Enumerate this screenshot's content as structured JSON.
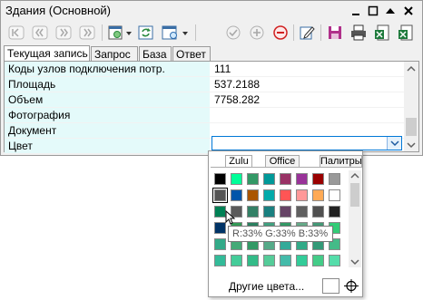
{
  "window": {
    "title": "Здания (Основной)"
  },
  "tabs": [
    {
      "label": "Текущая запись",
      "active": true
    },
    {
      "label": "Запрос",
      "active": false
    },
    {
      "label": "База",
      "active": false
    },
    {
      "label": "Ответ",
      "active": false
    }
  ],
  "rows": [
    {
      "name": "Коды узлов подключения потр.",
      "value": "111"
    },
    {
      "name": "Площадь",
      "value": "537.2188"
    },
    {
      "name": "Объем",
      "value": "7758.282"
    },
    {
      "name": "Фотография",
      "value": ""
    },
    {
      "name": "Документ",
      "value": ""
    },
    {
      "name": "Цвет",
      "value": ""
    }
  ],
  "color_popup": {
    "tabs": [
      "Zulu",
      "Office",
      "Палитры"
    ],
    "active_tab": "Zulu",
    "tooltip": "R:33% G:33% B:33%",
    "more_colors_label": "Другие цвета...",
    "swatches": [
      [
        "#000000",
        "#00ff99",
        "#339966",
        "#009999",
        "#993366",
        "#993399",
        "#990000",
        "#999999"
      ],
      [
        "#555555",
        "#0055aa",
        "#aa5500",
        "#00aaaa",
        "#ff5555",
        "#ff9999",
        "#ffaa55",
        "#ffffff"
      ],
      [
        "#008055",
        "#5a5a5a",
        "#338066",
        "#1a8080",
        "#664466",
        "#606060",
        "#505050",
        "#222222"
      ],
      [
        "#003366",
        "#339955",
        "#2a8060",
        "#40a080",
        "#339966",
        "#66aa88",
        "#449977",
        "#33cc77"
      ],
      [
        "#33aa88",
        "#44aa77",
        "#339966",
        "#55aa88",
        "#33aa99",
        "#33aa88",
        "#339977",
        "#44bb88"
      ],
      [
        "#33bb99",
        "#44cc99",
        "#33bb88",
        "#55cc99",
        "#44bbaa",
        "#33cc99",
        "#44cc88",
        "#55ddaa"
      ]
    ],
    "selected_swatch": [
      1,
      0
    ]
  },
  "colors": {
    "name_column_bg": "#e4fafa",
    "focus_border": "#0078d7",
    "save_icon": "#b0308a",
    "delete_icon": "#d02020"
  },
  "icons": {
    "toolbar": [
      "first-record-icon",
      "prev-record-icon",
      "next-record-icon",
      "last-record-icon",
      "query-menu-icon",
      "refresh-icon",
      "view-menu-icon",
      "apply-icon",
      "add-icon",
      "delete-icon",
      "edit-icon",
      "save-icon",
      "print-icon",
      "export-excel-icon",
      "export-csv-icon"
    ]
  }
}
